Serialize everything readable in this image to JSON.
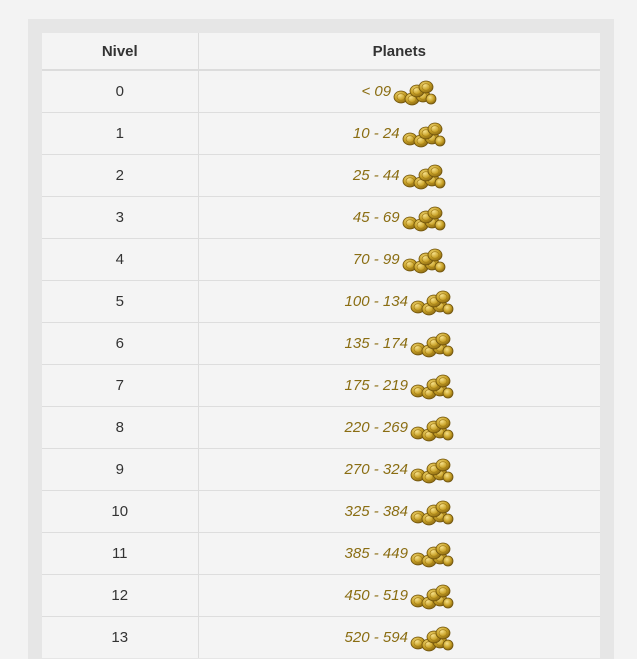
{
  "table": {
    "headers": {
      "level": "Nivel",
      "planets": "Planets"
    },
    "rows": [
      {
        "level": "0",
        "range": "< 09",
        "icon": "coins-icon"
      },
      {
        "level": "1",
        "range": "10 - 24",
        "icon": "coins-icon"
      },
      {
        "level": "2",
        "range": "25 - 44",
        "icon": "coins-icon"
      },
      {
        "level": "3",
        "range": "45 - 69",
        "icon": "coins-icon"
      },
      {
        "level": "4",
        "range": "70 - 99",
        "icon": "coins-icon"
      },
      {
        "level": "5",
        "range": "100 - 134",
        "icon": "coins-icon"
      },
      {
        "level": "6",
        "range": "135 - 174",
        "icon": "coins-icon"
      },
      {
        "level": "7",
        "range": "175 - 219",
        "icon": "coins-icon"
      },
      {
        "level": "8",
        "range": "220 - 269",
        "icon": "coins-icon"
      },
      {
        "level": "9",
        "range": "270 - 324",
        "icon": "coins-icon"
      },
      {
        "level": "10",
        "range": "325 - 384",
        "icon": "coins-icon"
      },
      {
        "level": "11",
        "range": "385 - 449",
        "icon": "coins-icon"
      },
      {
        "level": "12",
        "range": "450 - 519",
        "icon": "coins-icon"
      },
      {
        "level": "13",
        "range": "520 - 594",
        "icon": "coins-icon"
      }
    ]
  },
  "colors": {
    "range_text": "#8a6d12",
    "coin_gold": "#c9a227",
    "coin_shadow": "#8c6a12"
  }
}
